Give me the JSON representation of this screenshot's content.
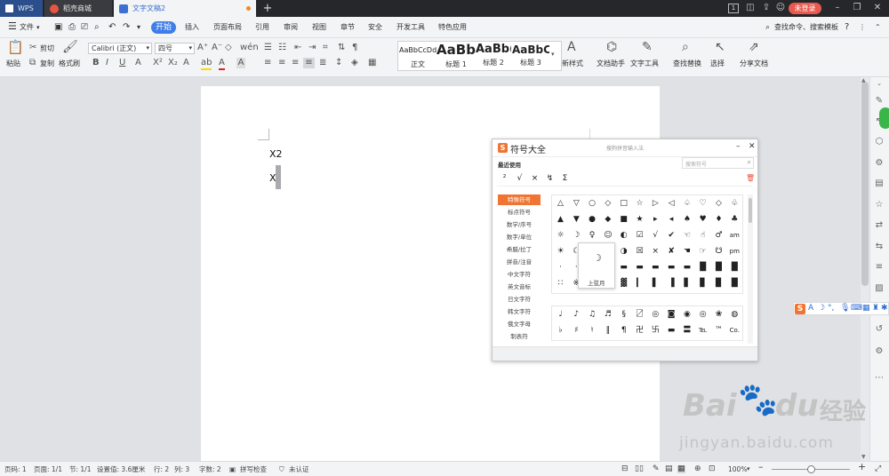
{
  "titlebar": {
    "tabs": [
      {
        "label": "WPS",
        "icon": "wps-logo-icon"
      },
      {
        "label": "稻壳商城",
        "icon": "docer-icon"
      },
      {
        "label": "文字文稿2",
        "icon": "writer-doc-icon"
      }
    ],
    "add_tab": "+",
    "badge": "1",
    "login": "未登录"
  },
  "menu": {
    "file": "文件",
    "items": [
      "开始",
      "插入",
      "页面布局",
      "引用",
      "审阅",
      "视图",
      "章节",
      "安全",
      "开发工具",
      "特色应用"
    ],
    "search": "查找命令、搜索模板"
  },
  "ribbon": {
    "paste": "粘贴",
    "cut": "剪切",
    "copy": "复制",
    "format_painter": "格式刷",
    "font_name": "Calibri (正文)",
    "font_size": "四号",
    "styles": [
      {
        "preview": "AaBbCcDd",
        "label": "正文"
      },
      {
        "preview": "AaBb",
        "label": "标题 1"
      },
      {
        "preview": "AaBb(",
        "label": "标题 2"
      },
      {
        "preview": "AaBbC",
        "label": "标题 3"
      }
    ],
    "new_style": "新样式",
    "doc_helper": "文档助手",
    "text_tools": "文字工具",
    "find_replace": "查找替换",
    "select": "选择",
    "share": "分享文档"
  },
  "document": {
    "lines": [
      "X2",
      "X"
    ]
  },
  "symbol_dialog": {
    "title": "符号大全",
    "subtitle": "搜狗拼音输入法",
    "recent_label": "最近使用",
    "search_placeholder": "搜索符号",
    "recent": [
      "²",
      "√",
      "×",
      "↯",
      "Σ"
    ],
    "categories": [
      "特殊符号",
      "标点符号",
      "数学/序号",
      "数字/单位",
      "希腊/拉丁",
      "拼音/注音",
      "中文字符",
      "英文音标",
      "日文字符",
      "韩文字符",
      "俄文字母",
      "制表符"
    ],
    "grid_rows": [
      [
        "△",
        "▽",
        "○",
        "◇",
        "□",
        "☆",
        "▷",
        "◁",
        "♤",
        "♡",
        "◇",
        "♧"
      ],
      [
        "▲",
        "▼",
        "●",
        "◆",
        "■",
        "★",
        "▸",
        "◂",
        "♠",
        "♥",
        "♦",
        "♣"
      ],
      [
        "☼",
        "☽",
        "♀",
        "☺",
        "◐",
        "☑",
        "√",
        "✔",
        "☜",
        "☝",
        "♂",
        "am"
      ],
      [
        "☀",
        "☾",
        "",
        "",
        "◑",
        "☒",
        "×",
        "✘",
        "☚",
        "☞",
        "☋",
        "pm"
      ],
      [
        "·",
        "·",
        "",
        "",
        "▬",
        "▬",
        "▬",
        "▬",
        "▬",
        "█",
        "█",
        "█"
      ],
      [
        "∷",
        "※",
        "",
        "",
        "▓",
        "▎",
        "▌",
        "▐",
        "▋",
        "▊",
        "▉",
        "█"
      ]
    ],
    "grid2_rows": [
      [
        "♩",
        "♪",
        "♫",
        "♬",
        "§",
        "〼",
        "◎",
        "◙",
        "◉",
        "◎",
        "❀",
        "◍"
      ],
      [
        "♭",
        "♯",
        "♮",
        "‖",
        "¶",
        "卍",
        "卐",
        "▬",
        "〓",
        "℡",
        "™",
        "Co."
      ]
    ],
    "tooltip_symbol": "☽",
    "tooltip_label": "上弦月"
  },
  "statusbar": {
    "page_num": "页码: 1",
    "pages": "页面: 1/1",
    "section": "节: 1/1",
    "setting": "设置值: 3.6厘米",
    "row": "行: 2",
    "col": "列: 3",
    "words": "字数: 2",
    "spellcheck": "拼写检查",
    "cert": "未认证",
    "zoom": "100%"
  },
  "watermark": {
    "brand": "Bai",
    "brand2": "du",
    "cn": "经验",
    "url": "jingyan.baidu.com"
  },
  "colors": {
    "accent": "#3f7ee8",
    "titlebar": "#26272b",
    "login": "#e85a4f",
    "sogou": "#f07532"
  }
}
